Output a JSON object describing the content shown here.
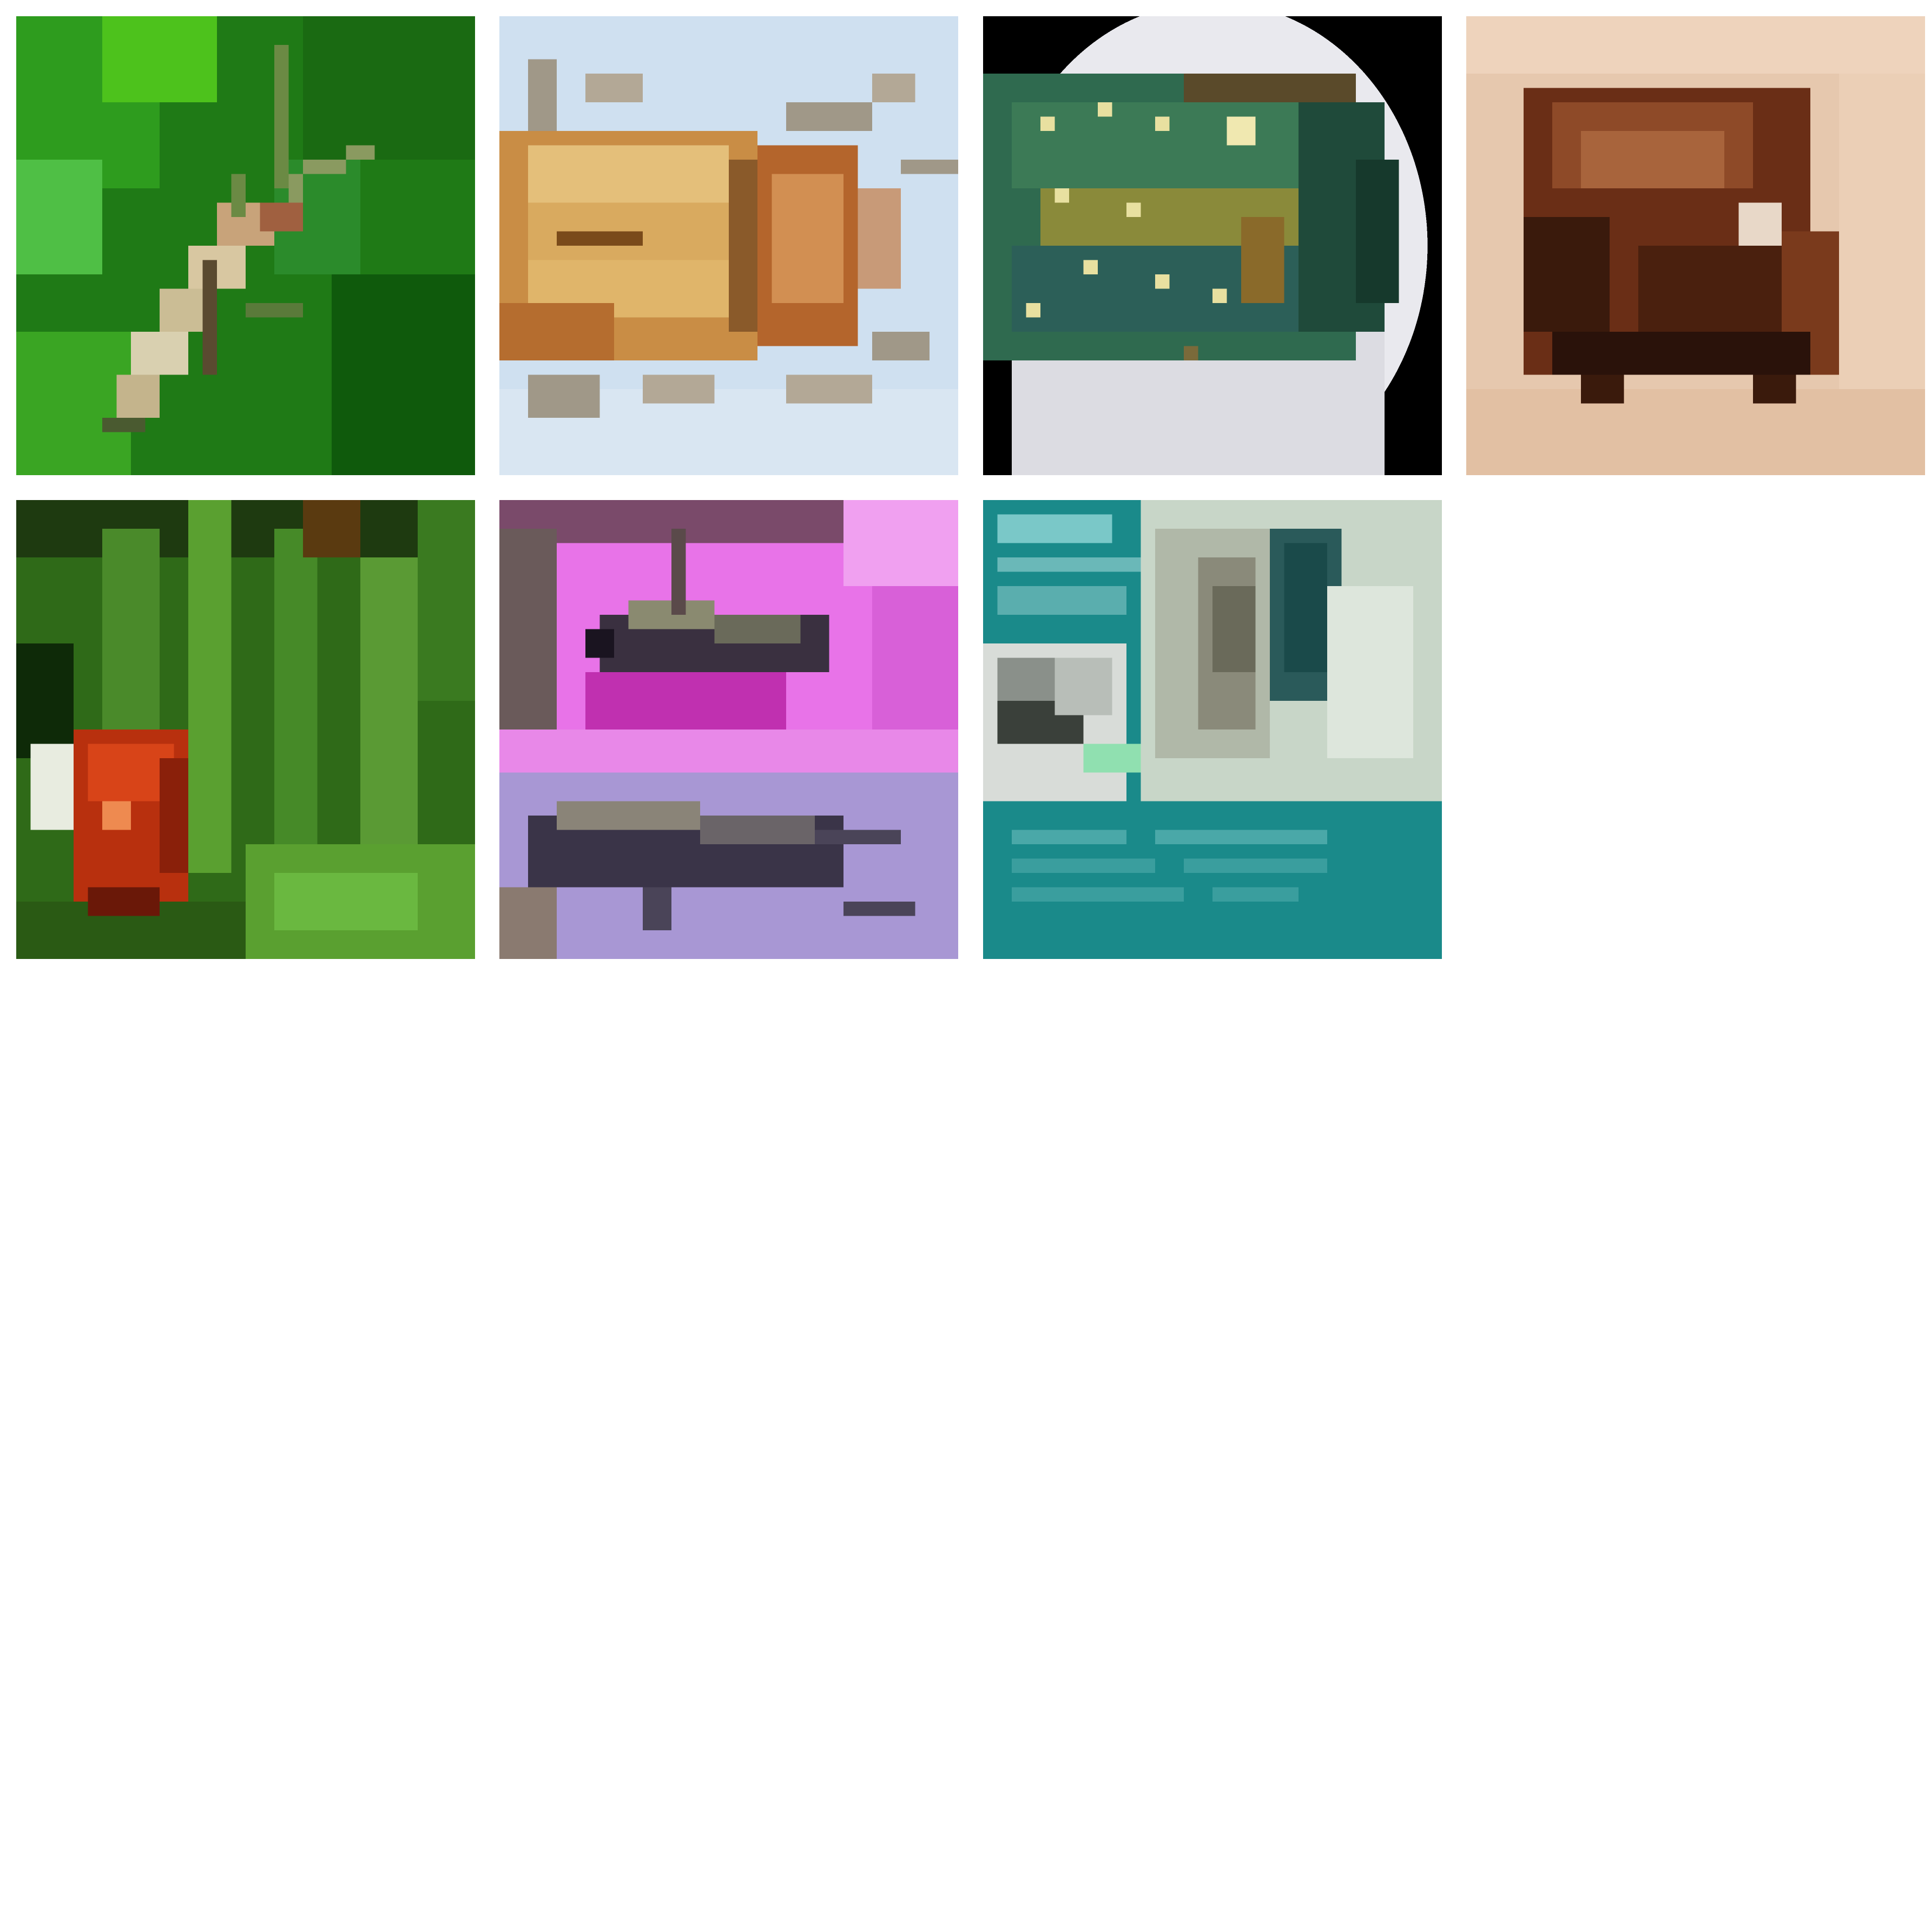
{
  "gallery": {
    "tiles": [
      {
        "subject": "beetle-on-green-leaves",
        "bg": "#2f8a1f"
      },
      {
        "subject": "golden-beetle-on-pale-blue",
        "bg": "#c9dcef"
      },
      {
        "subject": "green-spotted-beetle-in-dish",
        "bg": "#e8e8ec"
      },
      {
        "subject": "brown-beetle-on-sand",
        "bg": "#e8c9b0"
      },
      {
        "subject": "red-ladybug-in-grass",
        "bg": "#3d7a1e"
      },
      {
        "subject": "weevils-on-pink-and-violet",
        "bg": "#b39bd8"
      },
      {
        "subject": "beetle-specimen-card-teal",
        "bg": "#1a8f8f"
      }
    ]
  }
}
